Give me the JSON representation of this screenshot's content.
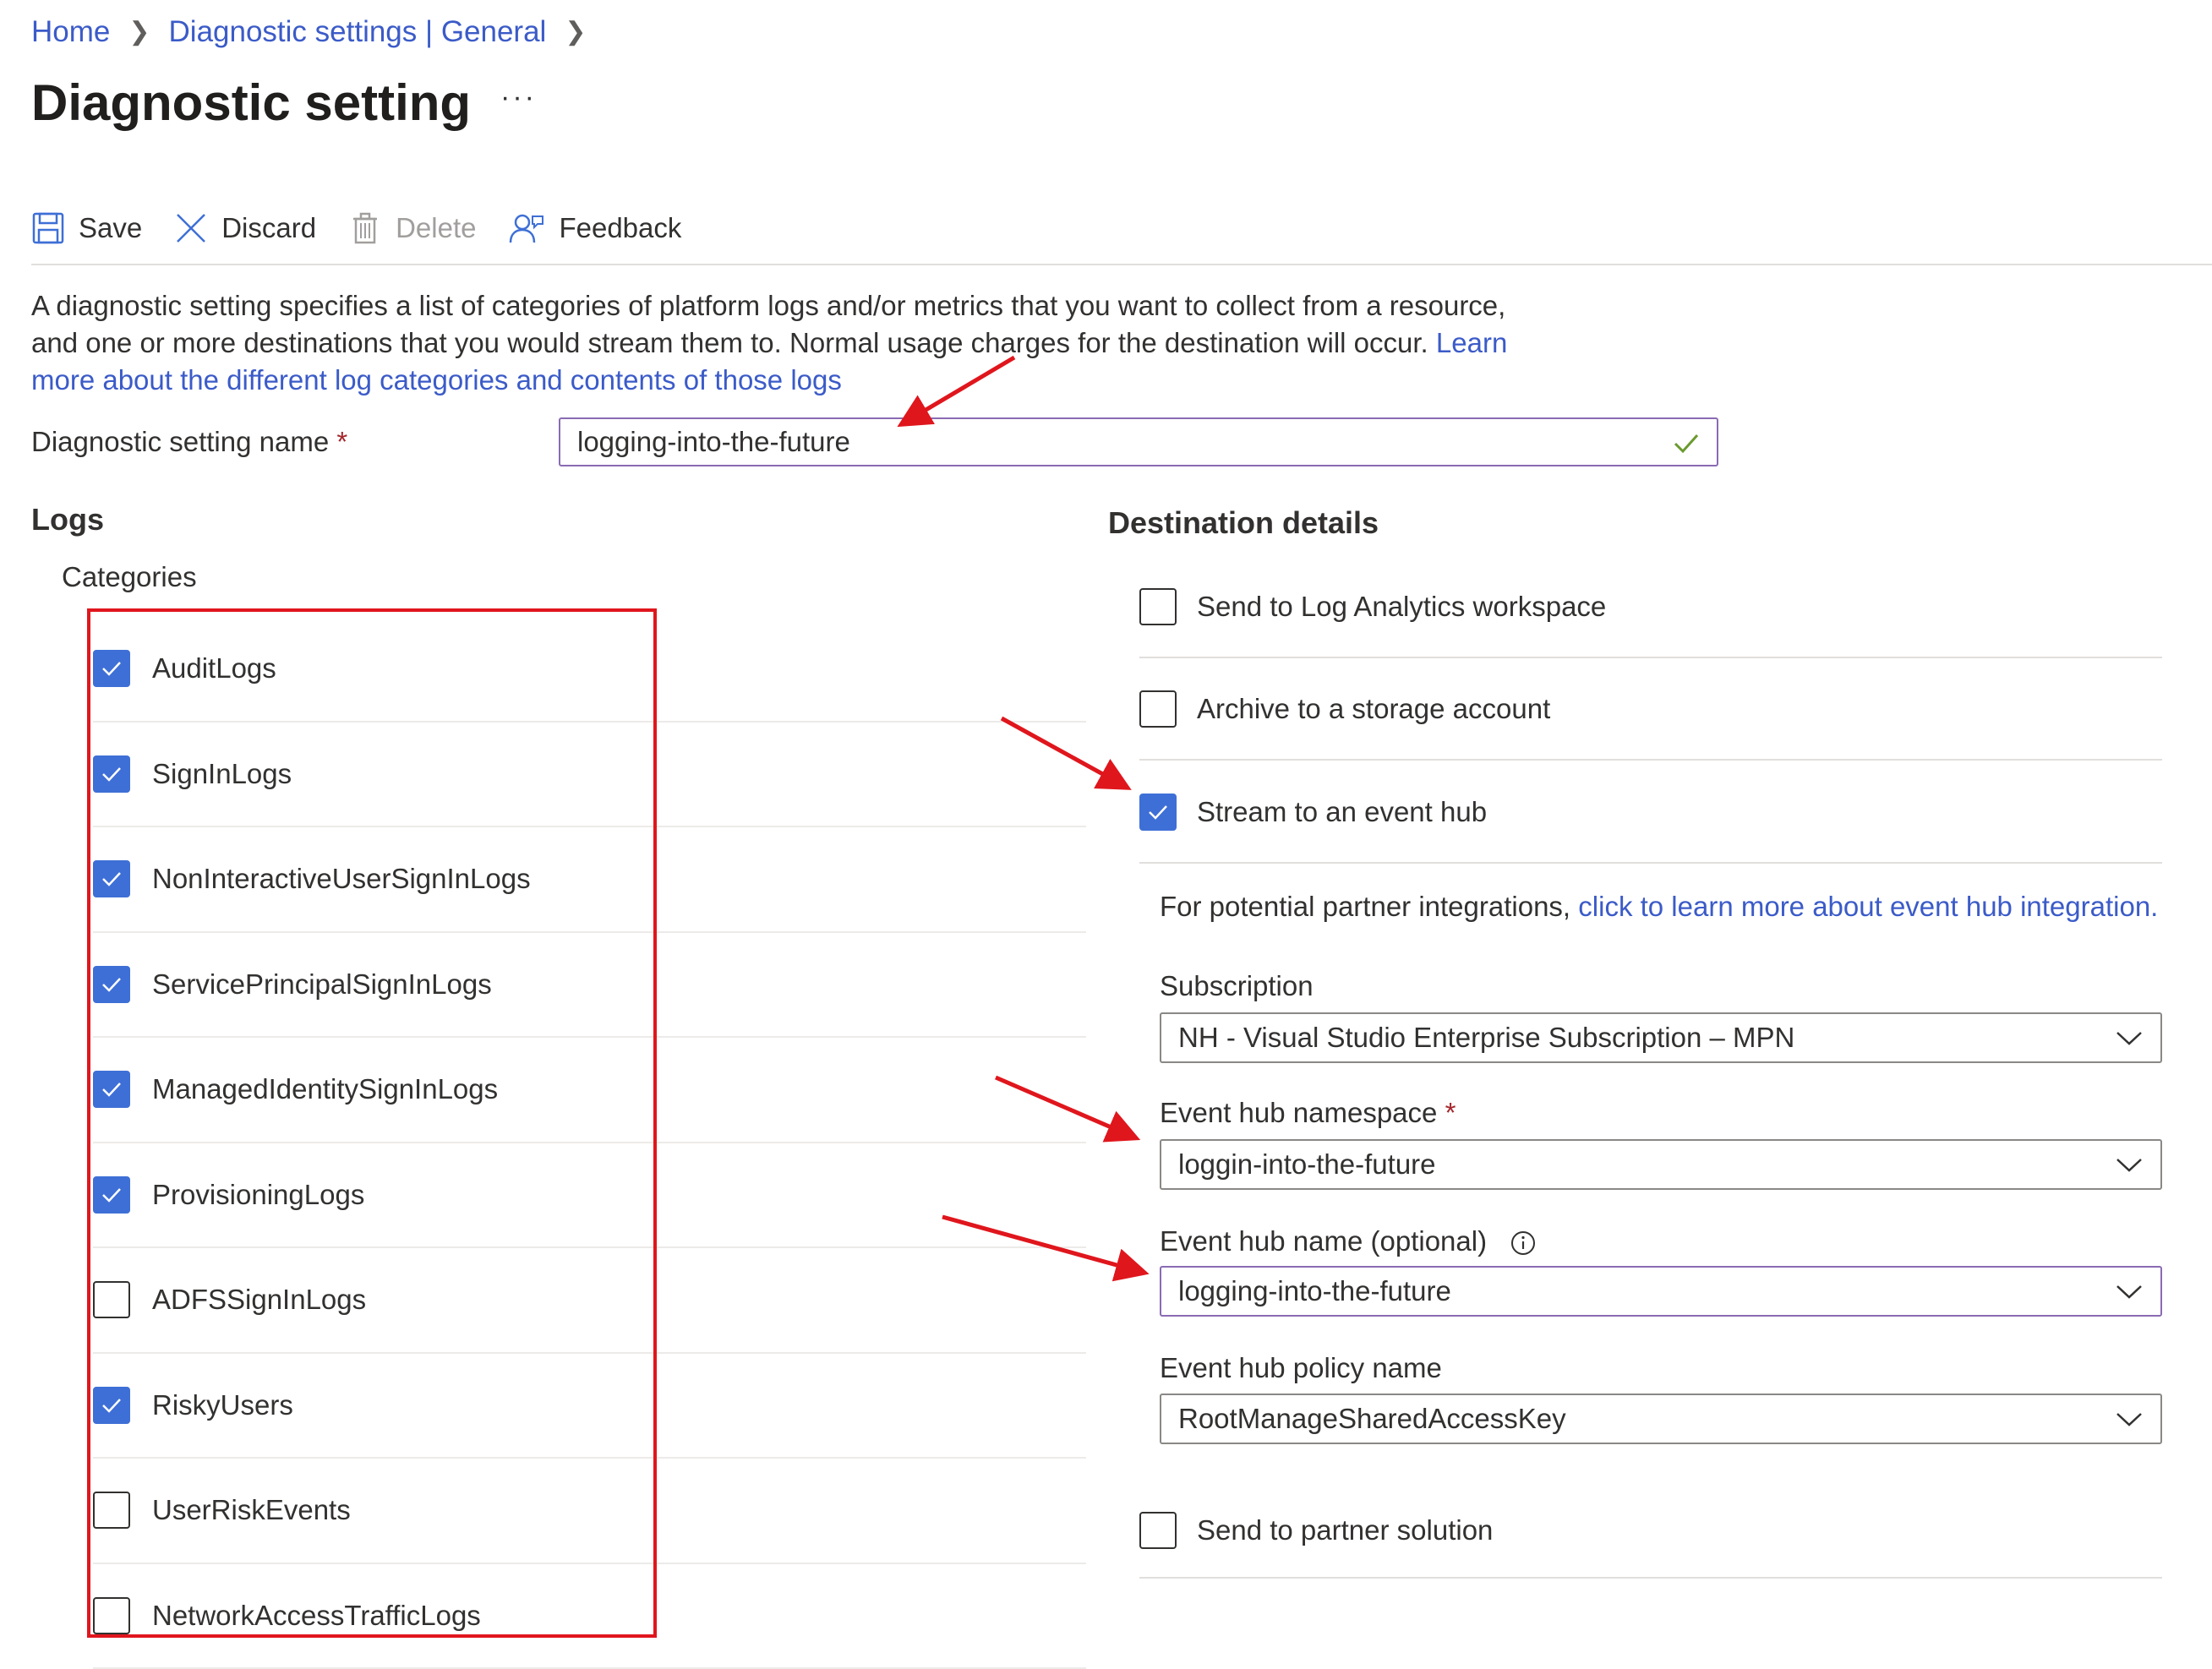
{
  "breadcrumb": {
    "items": [
      "Home",
      "Diagnostic settings | General"
    ]
  },
  "page": {
    "title": "Diagnostic setting",
    "more_label": "···"
  },
  "toolbar": {
    "save_label": "Save",
    "discard_label": "Discard",
    "delete_label": "Delete",
    "feedback_label": "Feedback"
  },
  "description": {
    "text": "A diagnostic setting specifies a list of categories of platform logs and/or metrics that you want to collect from a resource, and one or more destinations that you would stream them to. Normal usage charges for the destination will occur.",
    "link": "Learn more about the different log categories and contents of those logs"
  },
  "setting_name": {
    "label": "Diagnostic setting name",
    "required_mark": "*",
    "value": "logging-into-the-future",
    "valid": true
  },
  "logs": {
    "heading": "Logs",
    "categories_label": "Categories",
    "categories": [
      {
        "label": "AuditLogs",
        "checked": true
      },
      {
        "label": "SignInLogs",
        "checked": true
      },
      {
        "label": "NonInteractiveUserSignInLogs",
        "checked": true
      },
      {
        "label": "ServicePrincipalSignInLogs",
        "checked": true
      },
      {
        "label": "ManagedIdentitySignInLogs",
        "checked": true
      },
      {
        "label": "ProvisioningLogs",
        "checked": true
      },
      {
        "label": "ADFSSignInLogs",
        "checked": false
      },
      {
        "label": "RiskyUsers",
        "checked": true
      },
      {
        "label": "UserRiskEvents",
        "checked": false
      },
      {
        "label": "NetworkAccessTrafficLogs",
        "checked": false
      }
    ]
  },
  "destination": {
    "heading": "Destination details",
    "options": [
      {
        "label": "Send to Log Analytics workspace",
        "checked": false
      },
      {
        "label": "Archive to a storage account",
        "checked": false
      },
      {
        "label": "Stream to an event hub",
        "checked": true
      }
    ],
    "partner_note": "For potential partner integrations,",
    "partner_link": "click to learn more about event hub integration.",
    "subscription": {
      "label": "Subscription",
      "value": "NH - Visual Studio Enterprise Subscription – MPN"
    },
    "namespace": {
      "label": "Event hub namespace",
      "required_mark": "*",
      "value": "loggin-into-the-future"
    },
    "hub_name": {
      "label": "Event hub name (optional)",
      "value": "logging-into-the-future"
    },
    "policy": {
      "label": "Event hub policy name",
      "value": "RootManageSharedAccessKey"
    },
    "partner_solution": {
      "label": "Send to partner solution",
      "checked": false
    }
  },
  "colors": {
    "accent": "#3e6fd6",
    "link": "#3b5bc8",
    "annotation": "#e0161d",
    "focus_border": "#8a6bb3"
  }
}
